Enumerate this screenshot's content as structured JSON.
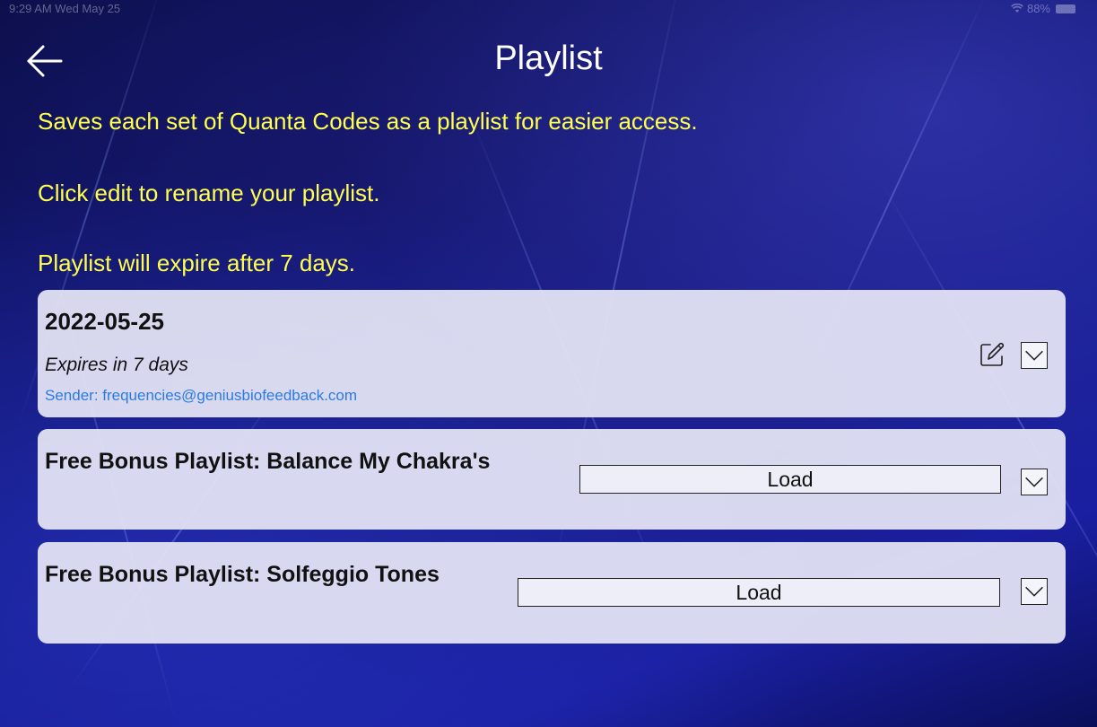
{
  "status_bar": {
    "time": "9:29 AM  Wed May 25",
    "battery": "88%"
  },
  "header": {
    "title": "Playlist",
    "back_icon": "arrow-left-icon"
  },
  "info": {
    "line1": "Saves each set of Quanta Codes as a playlist for easier access.",
    "line2": "Click edit to rename your playlist.",
    "line3": "Playlist will expire after 7 days."
  },
  "playlists": [
    {
      "title": "2022-05-25",
      "expires": "Expires in 7 days",
      "sender": "Sender: frequencies@geniusbiofeedback.com",
      "edit_icon": "pencil-edit-icon",
      "expand_icon": "chevron-down-icon"
    },
    {
      "title": "Free Bonus Playlist: Balance My Chakra's",
      "load_label": "Load",
      "expand_icon": "chevron-down-icon"
    },
    {
      "title": "Free Bonus Playlist: Solfeggio Tones",
      "load_label": "Load",
      "expand_icon": "chevron-down-icon"
    }
  ],
  "colors": {
    "info_text": "#ffff4d",
    "sender_link": "#2b7be0",
    "card_bg": "#e6e6f6"
  }
}
